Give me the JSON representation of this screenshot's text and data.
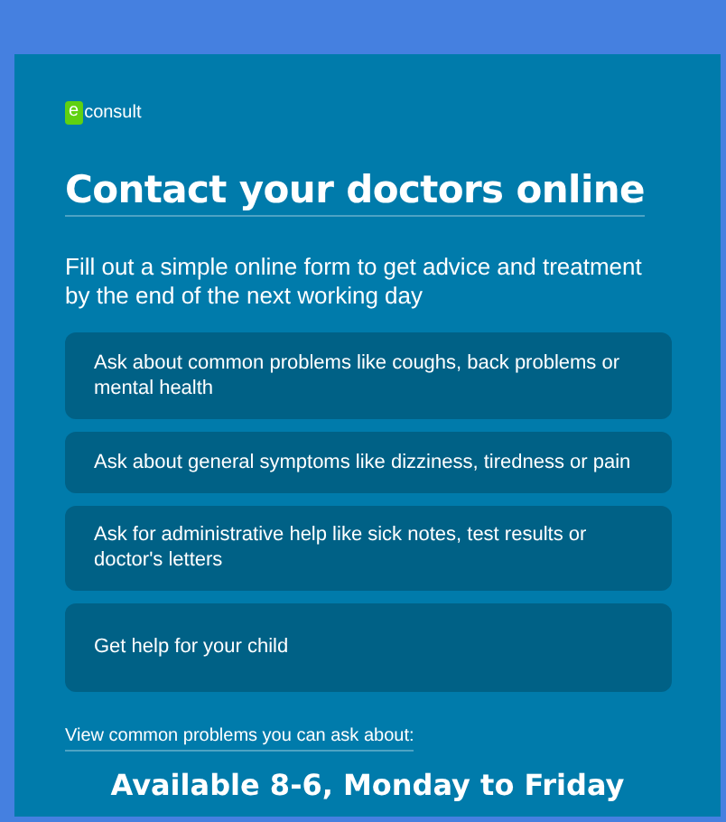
{
  "logo": {
    "mark": "e",
    "text": "consult"
  },
  "title": "Contact your doctors online",
  "intro": "Fill out a simple online form to get advice and treatment by the end of the next working day",
  "options": [
    {
      "label": "Ask about common problems like coughs, back problems or mental health"
    },
    {
      "label": "Ask about general symptoms like dizziness, tiredness or pain"
    },
    {
      "label": "Ask for administrative help like sick notes, test results or doctor's letters"
    },
    {
      "label": "Get help for your child"
    }
  ],
  "link": "View common problems you can ask about:",
  "availability": "Available 8-6, Monday to Friday"
}
